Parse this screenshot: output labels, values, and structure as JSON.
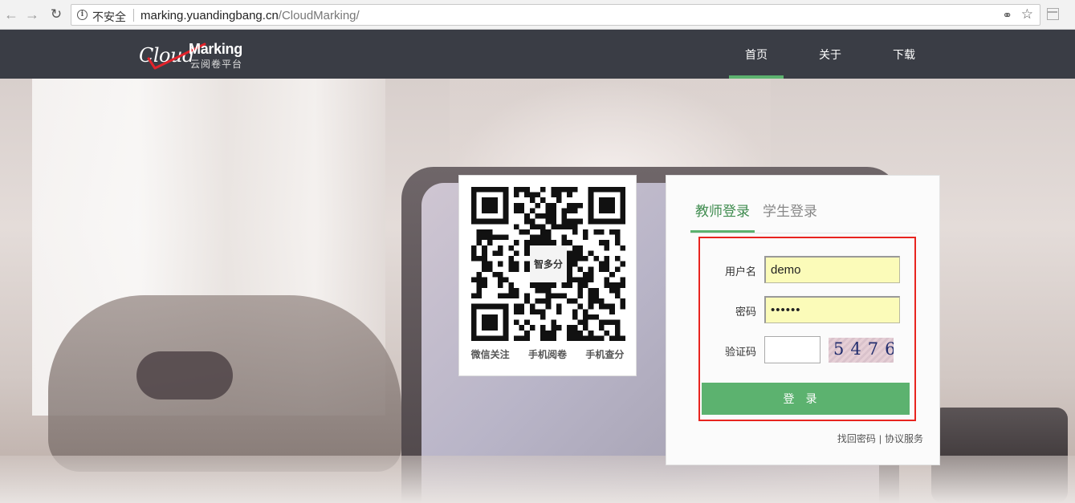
{
  "browser": {
    "security_label": "不安全",
    "url_host": "marking.yuandingbang.cn",
    "url_path": "/CloudMarking/"
  },
  "header": {
    "logo": {
      "cloud_text": "Cloud",
      "marking_text": "Marking",
      "subtitle": "云阅卷平台"
    },
    "nav": [
      {
        "label": "首页",
        "active": true
      },
      {
        "label": "关于",
        "active": false
      },
      {
        "label": "下载",
        "active": false
      }
    ],
    "accent_color": "#5cb26f",
    "background_color": "#3a3d45"
  },
  "qr": {
    "center_logo_text": "智多分",
    "captions": [
      "微信关注",
      "手机阅卷",
      "手机查分"
    ]
  },
  "login": {
    "tabs": [
      {
        "label": "教师登录",
        "active": true
      },
      {
        "label": "学生登录",
        "active": false
      }
    ],
    "fields": {
      "username_label": "用户名",
      "username_value": "demo",
      "password_label": "密码",
      "password_value": "••••••",
      "captcha_label": "验证码",
      "captcha_value": "",
      "captcha_image_text": "5476"
    },
    "submit_label": "登录",
    "links": [
      "找回密码",
      "协议服务"
    ],
    "link_separator": "|",
    "highlight_border_color": "#e8241f",
    "button_color": "#5cb26f"
  }
}
